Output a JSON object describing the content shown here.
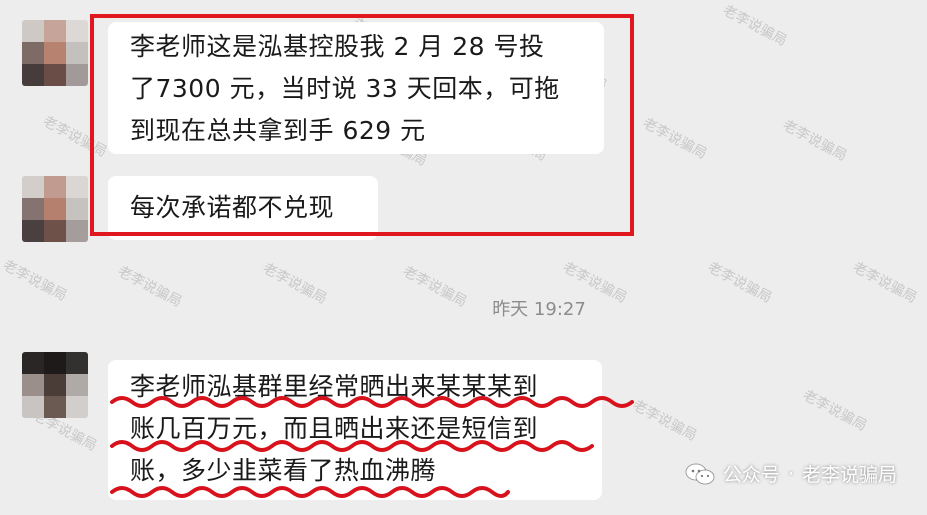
{
  "messages": [
    {
      "lines": [
        "李老师这是泓基控股我 2 月 28 号投",
        "了7300 元，当时说 33 天回本，可拖",
        "到现在总共拿到手 629 元"
      ]
    },
    {
      "lines": [
        "每次承诺都不兑现"
      ]
    },
    {
      "lines": [
        "李老师泓基群里经常晒出来某某某到",
        "账几百万元，而且晒出来还是短信到",
        "账，多少韭菜看了热血沸腾"
      ]
    }
  ],
  "timestamp": "昨天 19:27",
  "watermark_text": "老李说骗局",
  "footer": {
    "account_type": "公众号",
    "separator": "·",
    "account_name": "老李说骗局"
  },
  "colors": {
    "highlight_box": "#e0171f",
    "underline": "#d8121c",
    "background": "#ededed",
    "bubble": "#ffffff"
  }
}
